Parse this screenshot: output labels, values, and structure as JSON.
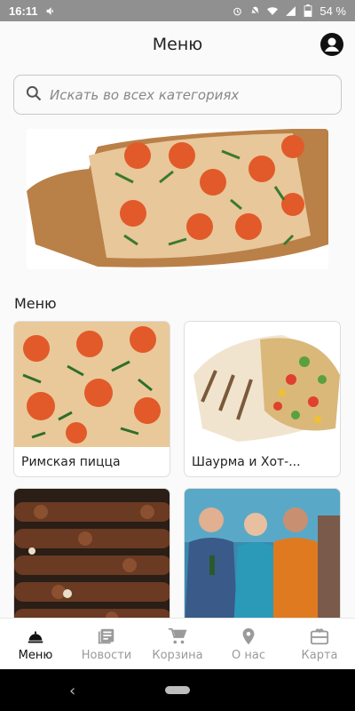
{
  "status_bar": {
    "time": "16:11",
    "battery": "54 %"
  },
  "app_bar": {
    "title": "Меню"
  },
  "search": {
    "placeholder": "Искать во всех категориях"
  },
  "section": {
    "title": "Меню"
  },
  "categories": [
    {
      "label": "Римская пицца"
    },
    {
      "label": "Шаурма и Хот-..."
    },
    {
      "label": ""
    },
    {
      "label": ""
    }
  ],
  "bottom_nav": [
    {
      "label": "Меню",
      "icon": "food-tray-icon",
      "active": true
    },
    {
      "label": "Новости",
      "icon": "news-icon",
      "active": false
    },
    {
      "label": "Корзина",
      "icon": "cart-icon",
      "active": false
    },
    {
      "label": "О нас",
      "icon": "location-pin-icon",
      "active": false
    },
    {
      "label": "Карта",
      "icon": "card-icon",
      "active": false
    }
  ],
  "colors": {
    "active": "#111111",
    "inactive": "#9a9a9a",
    "status_bar": "#909090"
  }
}
